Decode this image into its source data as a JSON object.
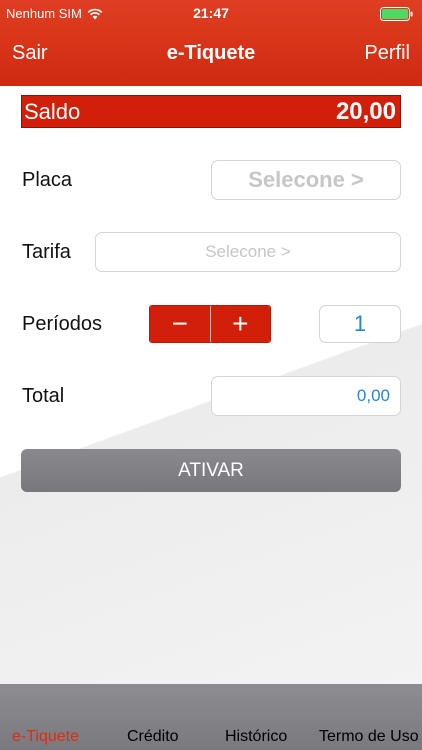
{
  "status": {
    "carrier": "Nenhum SIM",
    "time": "21:47"
  },
  "nav": {
    "left": "Sair",
    "title": "e-Tiquete",
    "right": "Perfil"
  },
  "saldo": {
    "label": "Saldo",
    "value": "20,00"
  },
  "form": {
    "placa_label": "Placa",
    "placa_value": "Selecone >",
    "tarifa_label": "Tarifa",
    "tarifa_value": "Selecone >",
    "periodos_label": "Períodos",
    "periodos_value": "1",
    "total_label": "Total",
    "total_value": "0,00"
  },
  "stepper": {
    "minus": "−",
    "plus": "+"
  },
  "ativar_label": "ATIVAR",
  "tabs": [
    {
      "label": "e-Tiquete",
      "active": true
    },
    {
      "label": "Crédito"
    },
    {
      "label": "Histórico"
    },
    {
      "label": "Termo de Uso"
    }
  ],
  "colors": {
    "accent": "#d11f0a",
    "value_blue": "#2a86c9",
    "button_gray": "#808085"
  }
}
